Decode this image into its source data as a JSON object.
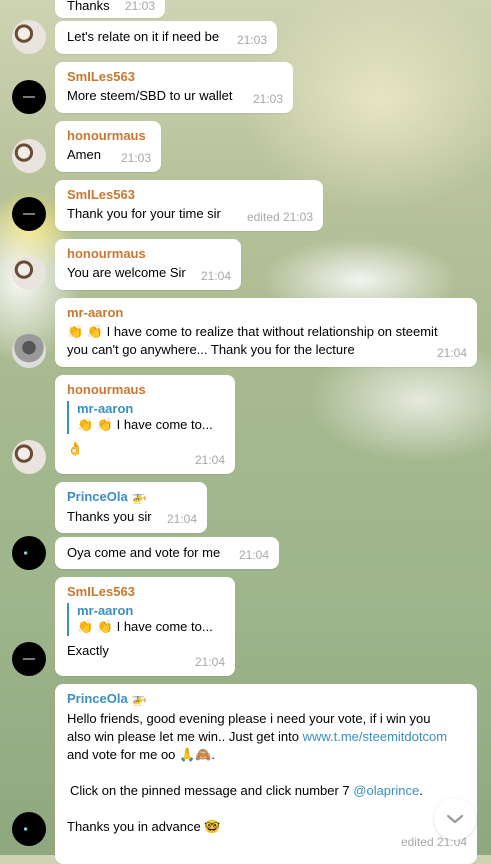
{
  "messages": [
    {
      "text": "Thanks",
      "time": "21:03"
    },
    {
      "text": "Let's relate on it if need be",
      "time": "21:03"
    },
    {
      "sender": "SmILes563",
      "text": "More steem/SBD to ur wallet",
      "time": "21:03"
    },
    {
      "sender": "honourmaus",
      "text": "Amen",
      "time": "21:03"
    },
    {
      "sender": "SmILes563",
      "text": "Thank you for your time sir",
      "time": "edited 21:03"
    },
    {
      "sender": "honourmaus",
      "text": "You are welcome Sir",
      "time": "21:04"
    },
    {
      "sender": "mr-aaron",
      "line1": "👏 👏 I have come to realize that without relationship on steemit",
      "line2": "you can't go anywhere... Thank you for the lecture",
      "time": "21:04"
    },
    {
      "sender": "honourmaus",
      "quote_name": "mr-aaron",
      "quote_text": "👏 👏 I have come to...",
      "text": "👌",
      "time": "21:04"
    },
    {
      "sender": "PrinceOla",
      "sender_badge": "🚁",
      "text": "Thanks you sir",
      "time": "21:04"
    },
    {
      "text": "Oya come and vote for me",
      "time": "21:04"
    },
    {
      "sender": "SmILes563",
      "quote_name": "mr-aaron",
      "quote_text": "👏 👏 I have come to...",
      "text": "Exactly",
      "time": "21:04"
    },
    {
      "sender": "PrinceOla",
      "sender_badge": "🚁",
      "line1": "Hello friends, good evening please  i need your vote, if i win you",
      "line2_pre": "also win please let me win.. Just get into ",
      "line2_link": "www.t.me/steemitdotcom",
      "line3": "and vote for me oo 🙏🙈.",
      "line4_pre": "Click on the pinned message and click number 7 ",
      "line4_link": "@olaprince",
      "line4_post": ".",
      "line5": "Thanks you in advance 🤓",
      "time": "edited 21:04"
    }
  ],
  "scroll_button_icon": "chevron-down-icon"
}
